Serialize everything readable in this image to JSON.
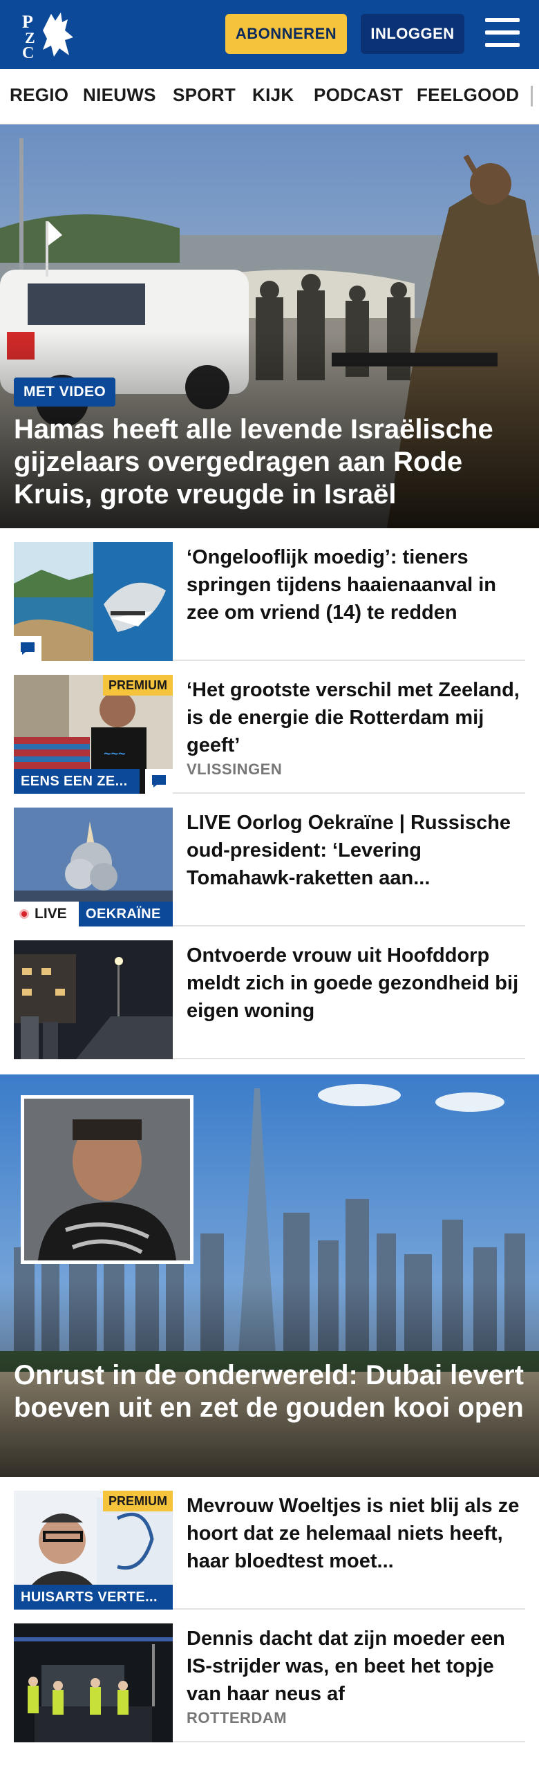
{
  "header": {
    "logo_text": "PZC",
    "subscribe_label": "ABONNEREN",
    "login_label": "INLOGGEN",
    "brand_color": "#0c4a99",
    "accent_color": "#f6c33c"
  },
  "nav": {
    "items": [
      "REGIO",
      "NIEUWS",
      "SPORT",
      "KIJK",
      "PODCAST",
      "FEELGOOD"
    ]
  },
  "hero": {
    "badge": "MET VIDEO",
    "title": "Hamas heeft alle levende Israëlische gijzelaars overgedragen aan Rode Kruis, grote vreugde in Israël"
  },
  "articles": [
    {
      "title": "‘Ongelooflijk moedig’: tieners springen tijdens haaienaanval in zee om vriend (14) te redden",
      "comment_icon": "comment-icon"
    },
    {
      "title": "‘Het grootste verschil met Zeeland, is de energie die Rotterdam mij geeft’",
      "premium": "PREMIUM",
      "section": "EENS EEN ZE...",
      "location": "VLISSINGEN",
      "comment_icon": "comment-icon"
    },
    {
      "title": "LIVE Oorlog Oekraïne | Russische oud-president: ‘Levering Tomahawk-raketten aan...",
      "live": "LIVE",
      "section": "OEKRAÏNE"
    },
    {
      "title": "Ontvoerde vrouw uit Hoofddorp meldt zich in goede gezondheid bij eigen woning"
    }
  ],
  "feature": {
    "title": "Onrust in de onderwereld: Dubai levert boeven uit en zet de gouden kooi open"
  },
  "articles2": [
    {
      "title": "Mevrouw Woeltjes is niet blij als ze hoort dat ze helemaal niets heeft, haar bloedtest moet...",
      "premium": "PREMIUM",
      "section": "HUISARTS VERTE..."
    },
    {
      "title": "Dennis dacht dat zijn moeder een IS-strijder was, en beet het topje van haar neus af",
      "location": "ROTTERDAM"
    }
  ]
}
